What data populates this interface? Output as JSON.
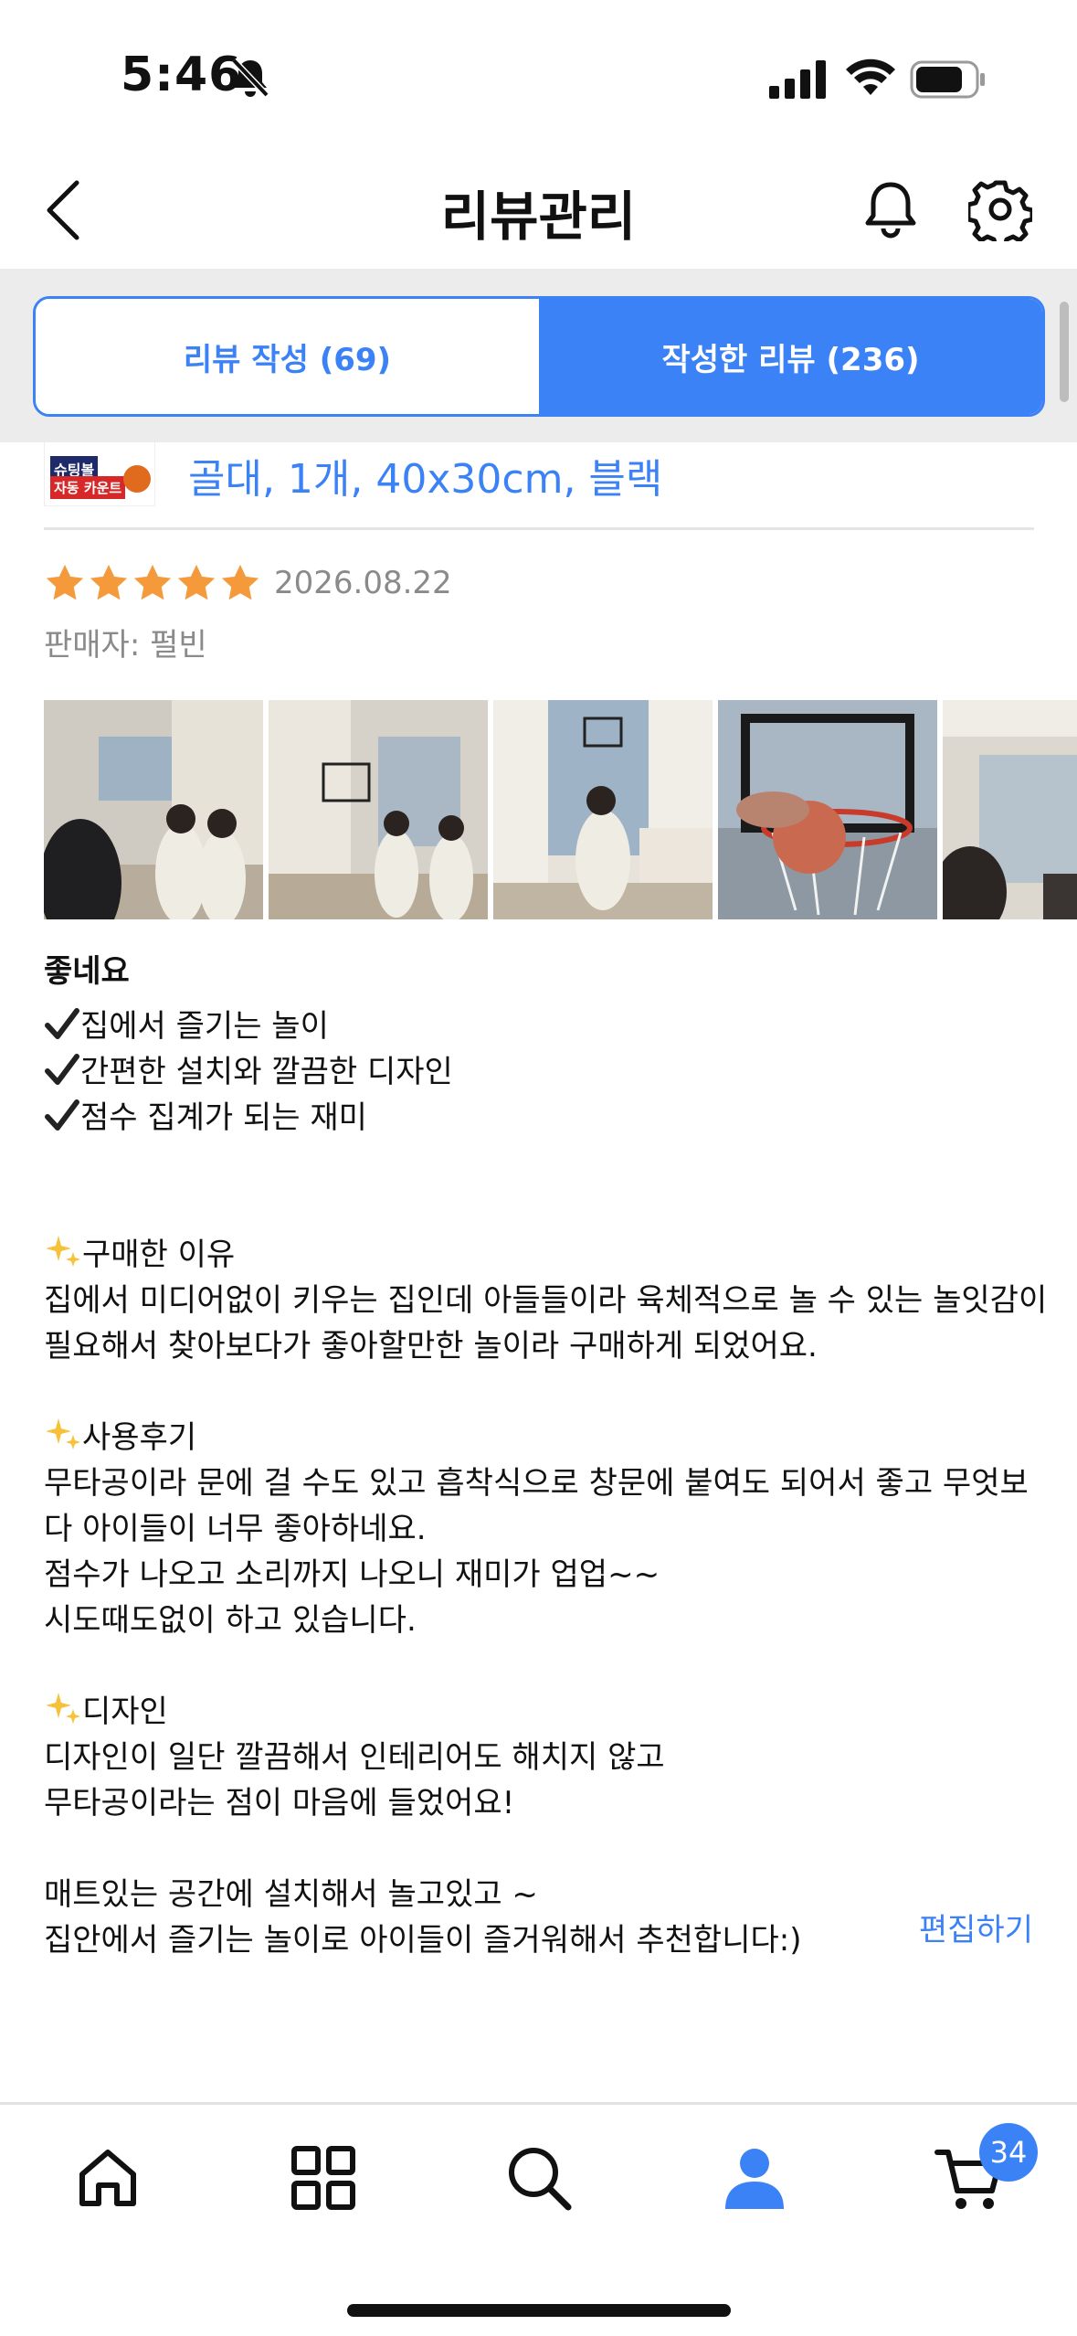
{
  "status": {
    "time": "5:46"
  },
  "header": {
    "title": "리뷰관리"
  },
  "tabs": [
    {
      "label": "리뷰 작성 (69)",
      "active": false
    },
    {
      "label": "작성한 리뷰 (236)",
      "active": true
    }
  ],
  "product": {
    "option": "골대, 1개, 40x30cm, 블랙",
    "thumb_text_1": "슈팅볼",
    "thumb_text_2": "자동 카운트"
  },
  "review": {
    "rating": 5,
    "date": "2026.08.22",
    "seller": "판매자: 펄빈",
    "photo_count": 5,
    "headline": "좋네요",
    "checks": [
      "집에서 즐기는 놀이",
      "간편한 설치와 깔끔한 디자인",
      "점수 집계가 되는 재미"
    ],
    "sections": [
      {
        "title": "구매한 이유",
        "lines": [
          "집에서 미디어없이 키우는 집인데 아들들이라 육체적으로 놀 수 있는 놀잇감이",
          "필요해서 찾아보다가 좋아할만한 놀이라 구매하게 되었어요."
        ]
      },
      {
        "title": "사용후기",
        "lines": [
          "무타공이라 문에 걸 수도 있고 흡착식으로 창문에 붙여도 되어서 좋고 무엇보",
          "다 아이들이 너무 좋아하네요.",
          "점수가 나오고 소리까지 나오니 재미가 업업~~",
          "시도때도없이 하고 있습니다."
        ]
      },
      {
        "title": "디자인",
        "lines": [
          "디자인이 일단 깔끔해서 인테리어도 해치지 않고",
          "무타공이라는 점이 마음에 들었어요!"
        ]
      }
    ],
    "closing": [
      "매트있는 공간에 설치해서 놀고있고 ~",
      "집안에서 즐기는 놀이로 아이들이 즐거워해서 추천합니다:)"
    ],
    "edit_label": "편집하기"
  },
  "nav": {
    "items": [
      "home-icon",
      "category-grid-icon",
      "search-icon",
      "profile-icon",
      "cart-icon"
    ],
    "active": "profile-icon",
    "cart_badge": "34"
  },
  "colors": {
    "accent": "#3b82f6",
    "star": "#f59a3b"
  }
}
